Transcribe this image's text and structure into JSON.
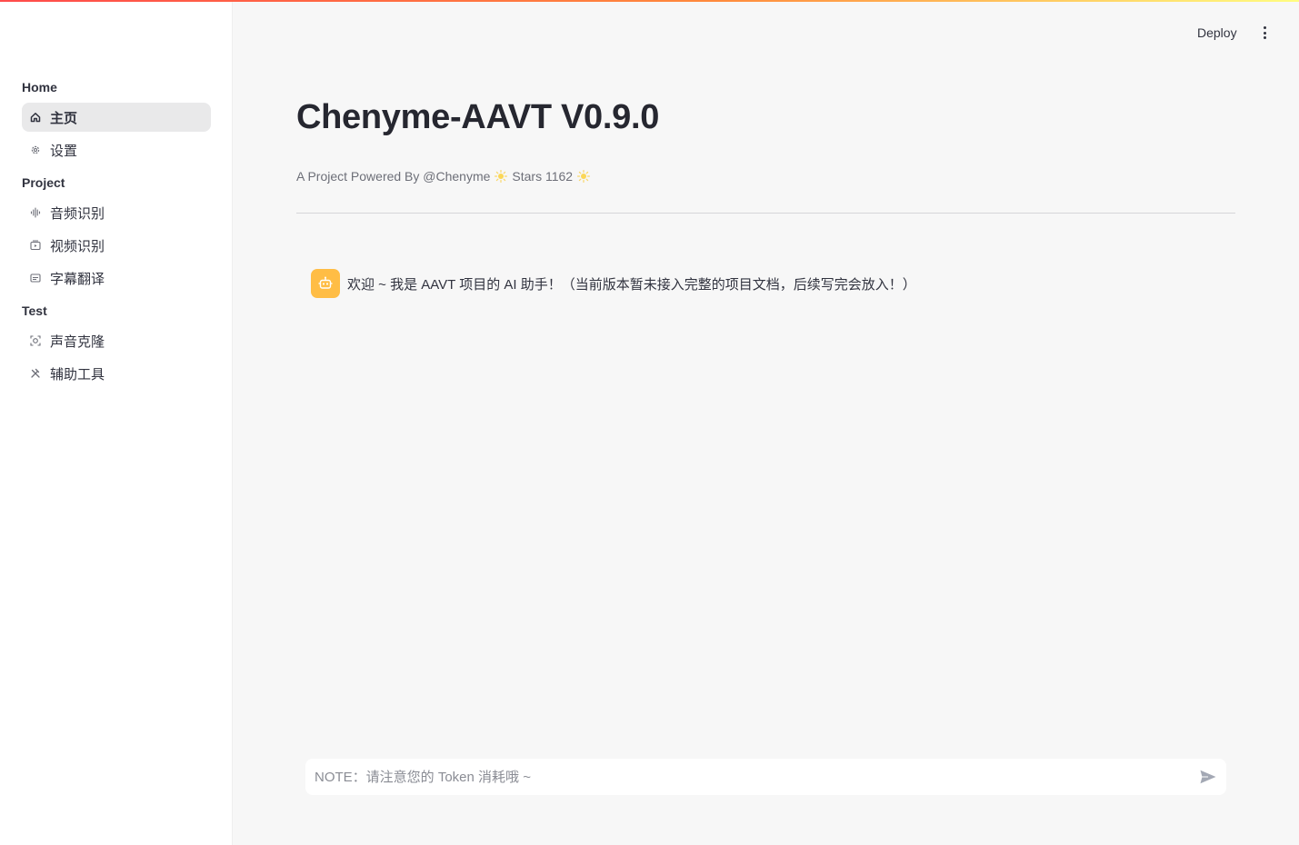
{
  "sidebar": {
    "sections": [
      {
        "label": "Home"
      },
      {
        "label": "Project"
      },
      {
        "label": "Test"
      }
    ],
    "items": [
      {
        "label": "主页",
        "icon": "home-icon",
        "active": true
      },
      {
        "label": "设置",
        "icon": "gear-icon"
      },
      {
        "label": "音频识别",
        "icon": "audio-waveform-icon"
      },
      {
        "label": "视频识别",
        "icon": "video-icon"
      },
      {
        "label": "字幕翻译",
        "icon": "subtitles-icon"
      },
      {
        "label": "声音克隆",
        "icon": "face-scan-icon"
      },
      {
        "label": "辅助工具",
        "icon": "tools-icon"
      }
    ]
  },
  "header": {
    "deploy_label": "Deploy",
    "menu_icon": "more-vert-icon"
  },
  "main": {
    "title": "Chenyme-AAVT V0.9.0",
    "subtitle_prefix": "A Project Powered By @Chenyme",
    "subtitle_stars": "Stars 1162",
    "message": {
      "avatar_icon": "robot-icon",
      "text": "欢迎 ~ 我是 AAVT 项目的 AI 助手！（当前版本暂未接入完整的项目文档，后续写完会放入！）"
    },
    "chat_input": {
      "placeholder": "NOTE：请注意您的 Token 消耗哦 ~",
      "value": "",
      "send_icon": "send-icon"
    }
  },
  "colors": {
    "accent_gradient_start": "#ff4b4b",
    "accent_gradient_end": "#fffd80",
    "avatar_bg": "#ffbd45",
    "sidebar_active_bg": "#e9e9ea"
  }
}
